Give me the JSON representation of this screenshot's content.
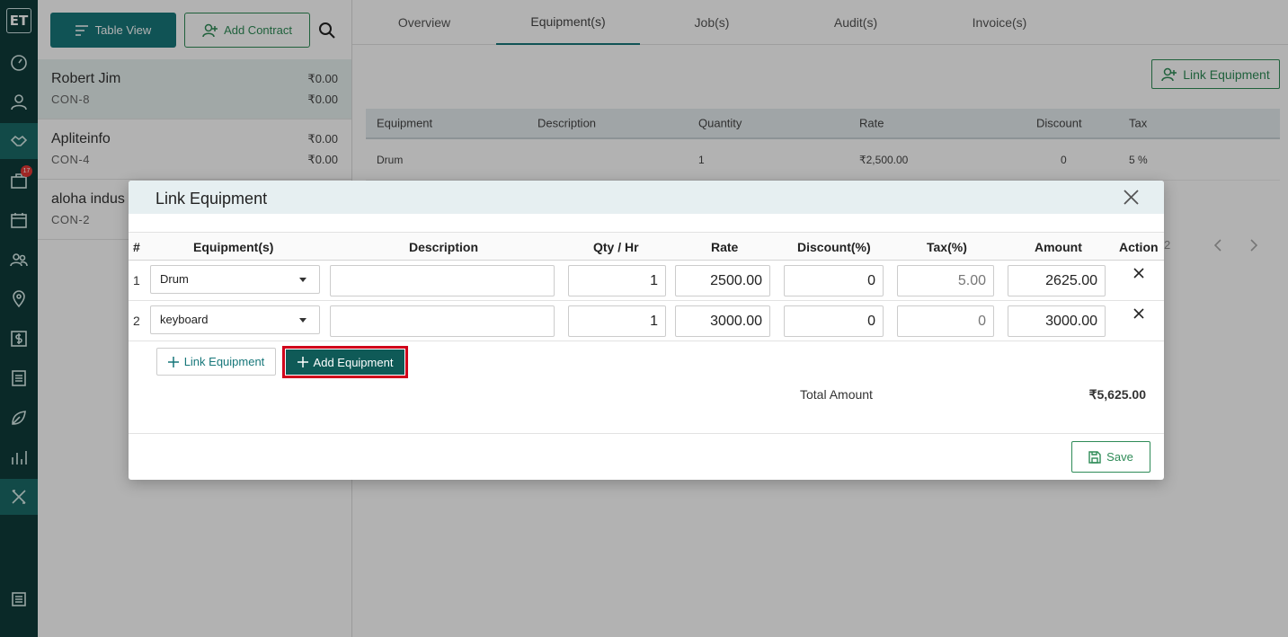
{
  "rail": {
    "logo": "ET",
    "notification_count": "17",
    "icons": [
      "dashboard-icon",
      "user-icon",
      "handshake-icon",
      "briefcase-icon",
      "calendar-icon",
      "users-icon",
      "location-icon",
      "dollar-icon",
      "list-icon",
      "leaf-icon",
      "bar-chart-icon",
      "tools-icon",
      "settings-icon"
    ]
  },
  "list": {
    "table_view_label": "Table View",
    "add_contract_label": "Add Contract",
    "contracts": [
      {
        "name": "Robert Jim",
        "code": "CON-8",
        "amount1": "₹0.00",
        "amount2": "₹0.00"
      },
      {
        "name": "Apliteinfo",
        "code": "CON-4",
        "amount1": "₹0.00",
        "amount2": "₹0.00"
      },
      {
        "name": "aloha indus",
        "code": "CON-2",
        "amount1": "",
        "amount2": ""
      }
    ]
  },
  "tabs": [
    "Overview",
    "Equipment(s)",
    "Job(s)",
    "Audit(s)",
    "Invoice(s)"
  ],
  "content": {
    "link_equipment_label": "Link Equipment",
    "table_headers": [
      "Equipment",
      "Description",
      "Quantity",
      "Rate",
      "Discount",
      "Tax"
    ],
    "rows": [
      {
        "equipment": "Drum",
        "description": "",
        "quantity": "1",
        "rate": "₹2,500.00",
        "discount": "0",
        "tax": "5 %"
      }
    ],
    "pager_text": "2"
  },
  "modal": {
    "title": "Link Equipment",
    "headers": {
      "num": "#",
      "equipment": "Equipment(s)",
      "description": "Description",
      "qty": "Qty / Hr",
      "rate": "Rate",
      "discount": "Discount(%)",
      "tax": "Tax(%)",
      "amount": "Amount",
      "action": "Action"
    },
    "rows": [
      {
        "num": "1",
        "equipment": "Drum",
        "description": "",
        "qty": "1",
        "rate": "2500.00",
        "discount": "0",
        "tax": "5.00",
        "amount": "2625.00"
      },
      {
        "num": "2",
        "equipment": "keyboard",
        "description": "",
        "qty": "1",
        "rate": "3000.00",
        "discount": "0",
        "tax": "0",
        "amount": "3000.00"
      }
    ],
    "link_equipment_label": "Link Equipment",
    "add_equipment_label": "Add Equipment",
    "total_label": "Total Amount",
    "total_value": "₹5,625.00",
    "save_label": "Save"
  }
}
